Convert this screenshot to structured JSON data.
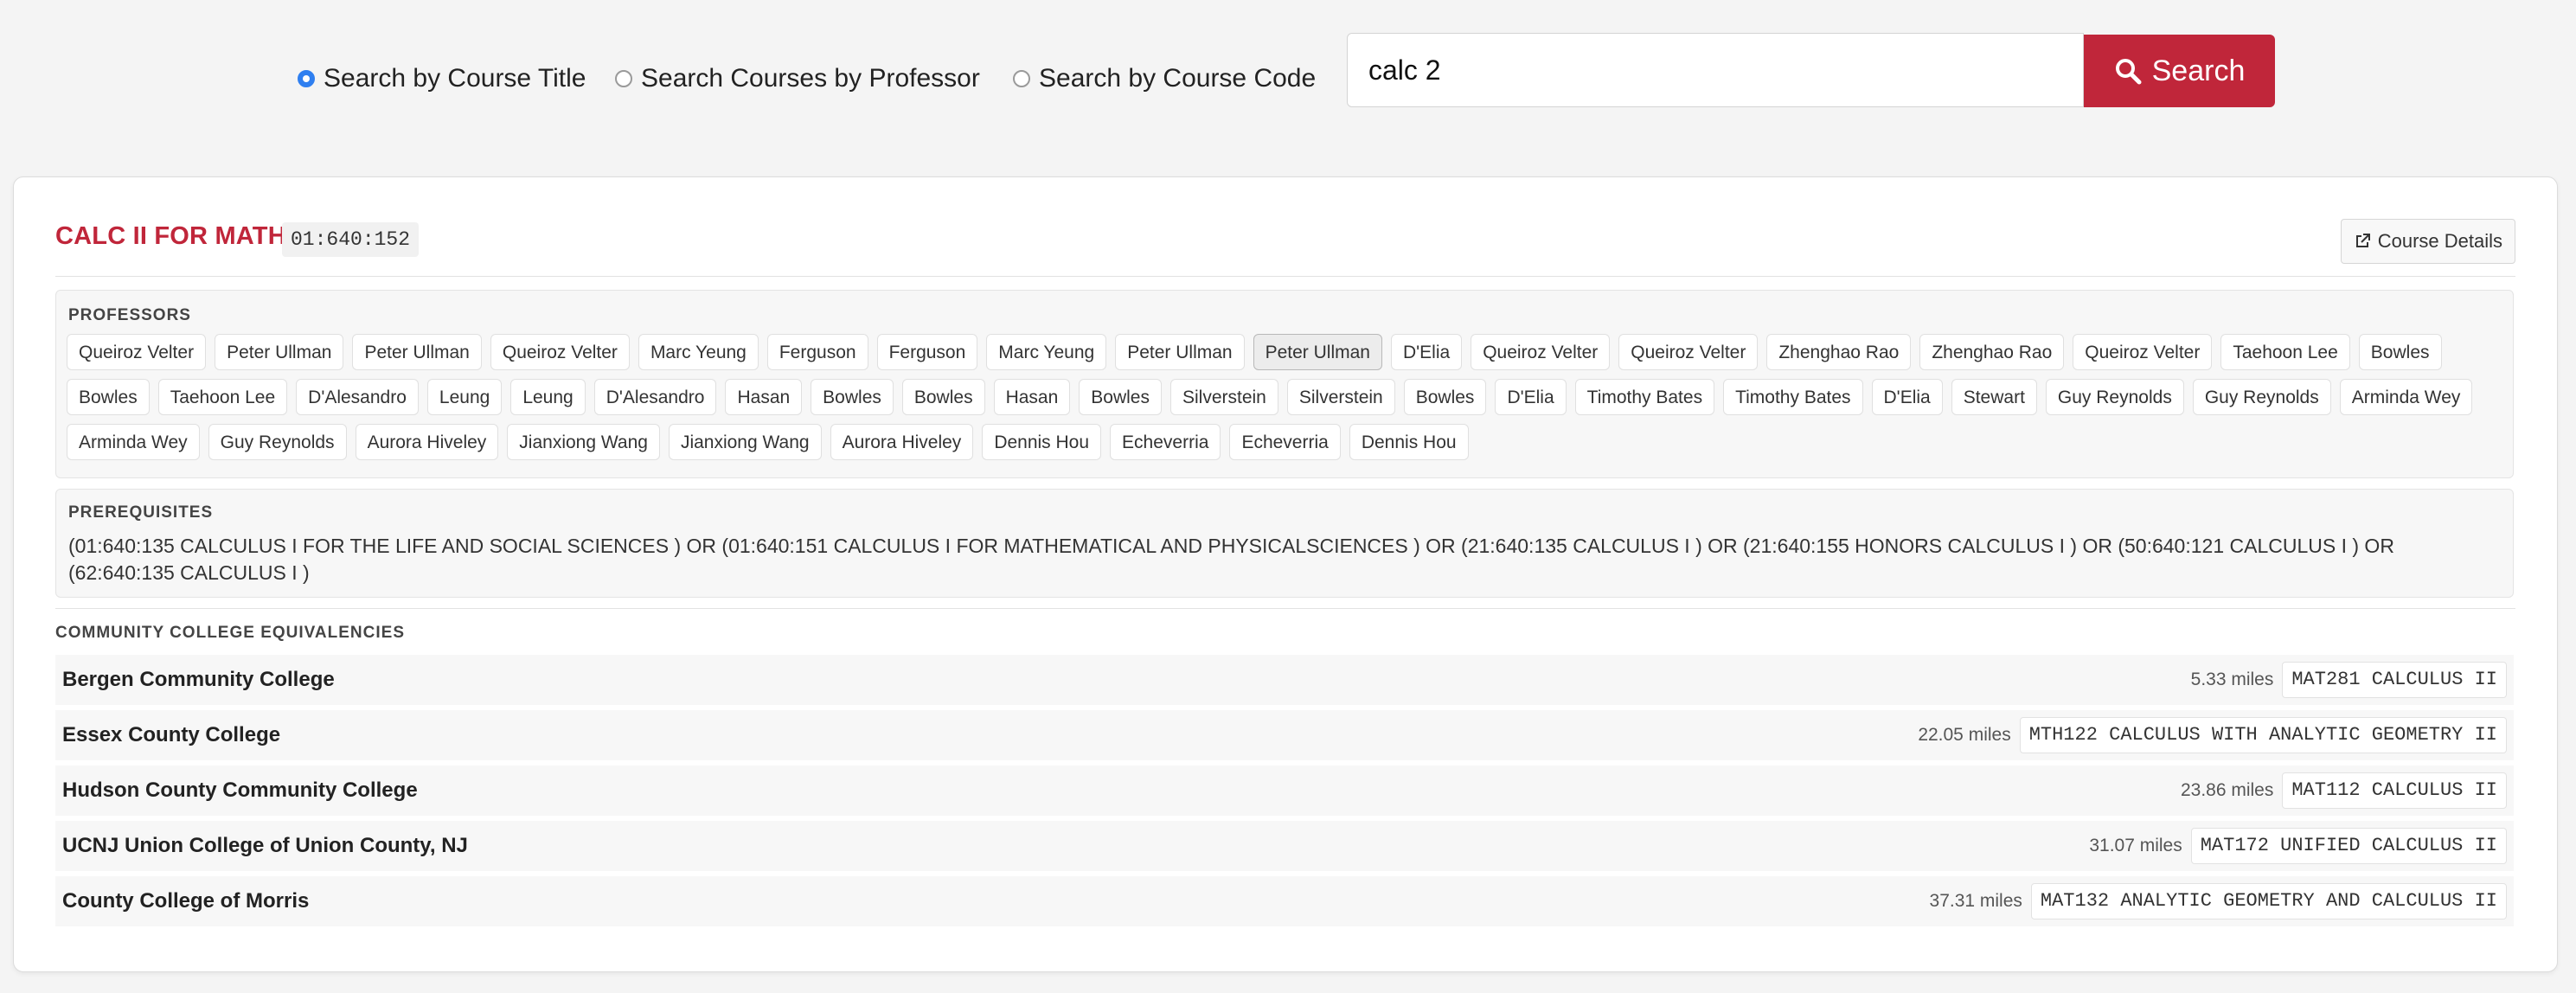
{
  "search": {
    "options": [
      {
        "label": "Search by Course Title",
        "checked": true
      },
      {
        "label": "Search Courses by Professor",
        "checked": false
      },
      {
        "label": "Search by Course Code",
        "checked": false
      }
    ],
    "query": "calc 2",
    "button_label": "Search",
    "button_icon": "search-icon"
  },
  "course": {
    "title": "CALC II FOR MATH",
    "code": "01:640:152",
    "details_label": "Course Details",
    "details_icon": "external-link-icon",
    "professors_heading": "PROFESSORS",
    "professors": [
      "Queiroz Velter",
      "Peter Ullman",
      "Peter Ullman",
      "Queiroz Velter",
      "Marc Yeung",
      "Ferguson",
      "Ferguson",
      "Marc Yeung",
      "Peter Ullman",
      "Peter Ullman",
      "D'Elia",
      "Queiroz Velter",
      "Queiroz Velter",
      "Zhenghao Rao",
      "Zhenghao Rao",
      "Queiroz Velter",
      "Taehoon Lee",
      "Bowles",
      "Bowles",
      "Taehoon Lee",
      "D'Alesandro",
      "Leung",
      "Leung",
      "D'Alesandro",
      "Hasan",
      "Bowles",
      "Bowles",
      "Hasan",
      "Bowles",
      "Silverstein",
      "Silverstein",
      "Bowles",
      "D'Elia",
      "Timothy Bates",
      "Timothy Bates",
      "D'Elia",
      "Stewart",
      "Guy Reynolds",
      "Guy Reynolds",
      "Arminda Wey",
      "Arminda Wey",
      "Guy Reynolds",
      "Aurora Hiveley",
      "Jianxiong Wang",
      "Jianxiong Wang",
      "Aurora Hiveley",
      "Dennis Hou",
      "Echeverria",
      "Echeverria",
      "Dennis Hou"
    ],
    "active_professor_index": 9,
    "prerequisites_heading": "PREREQUISITES",
    "prerequisites": "(01:640:135 CALCULUS I FOR THE LIFE AND SOCIAL SCIENCES ) OR (01:640:151 CALCULUS I FOR MATHEMATICAL AND PHYSICALSCIENCES ) OR (21:640:135 CALCULUS I ) OR (21:640:155 HONORS CALCULUS I ) OR (50:640:121 CALCULUS I ) OR (62:640:135 CALCULUS I )",
    "cc_heading": "COMMUNITY COLLEGE EQUIVALENCIES",
    "equivalencies": [
      {
        "college": "Bergen Community College",
        "distance": "5.33 miles",
        "code": "MAT281 CALCULUS II"
      },
      {
        "college": "Essex County College",
        "distance": "22.05 miles",
        "code": "MTH122 CALCULUS WITH ANALYTIC GEOMETRY II"
      },
      {
        "college": "Hudson County Community College",
        "distance": "23.86 miles",
        "code": "MAT112 CALCULUS II"
      },
      {
        "college": "UCNJ Union College of Union County, NJ",
        "distance": "31.07 miles",
        "code": "MAT172 UNIFIED CALCULUS II"
      },
      {
        "college": "County College of Morris",
        "distance": "37.31 miles",
        "code": "MAT132 ANALYTIC GEOMETRY AND CALCULUS II"
      }
    ]
  },
  "colors": {
    "accent": "#c0263a",
    "radio_checked": "#2f7ff0",
    "background": "#f4f4f4"
  }
}
